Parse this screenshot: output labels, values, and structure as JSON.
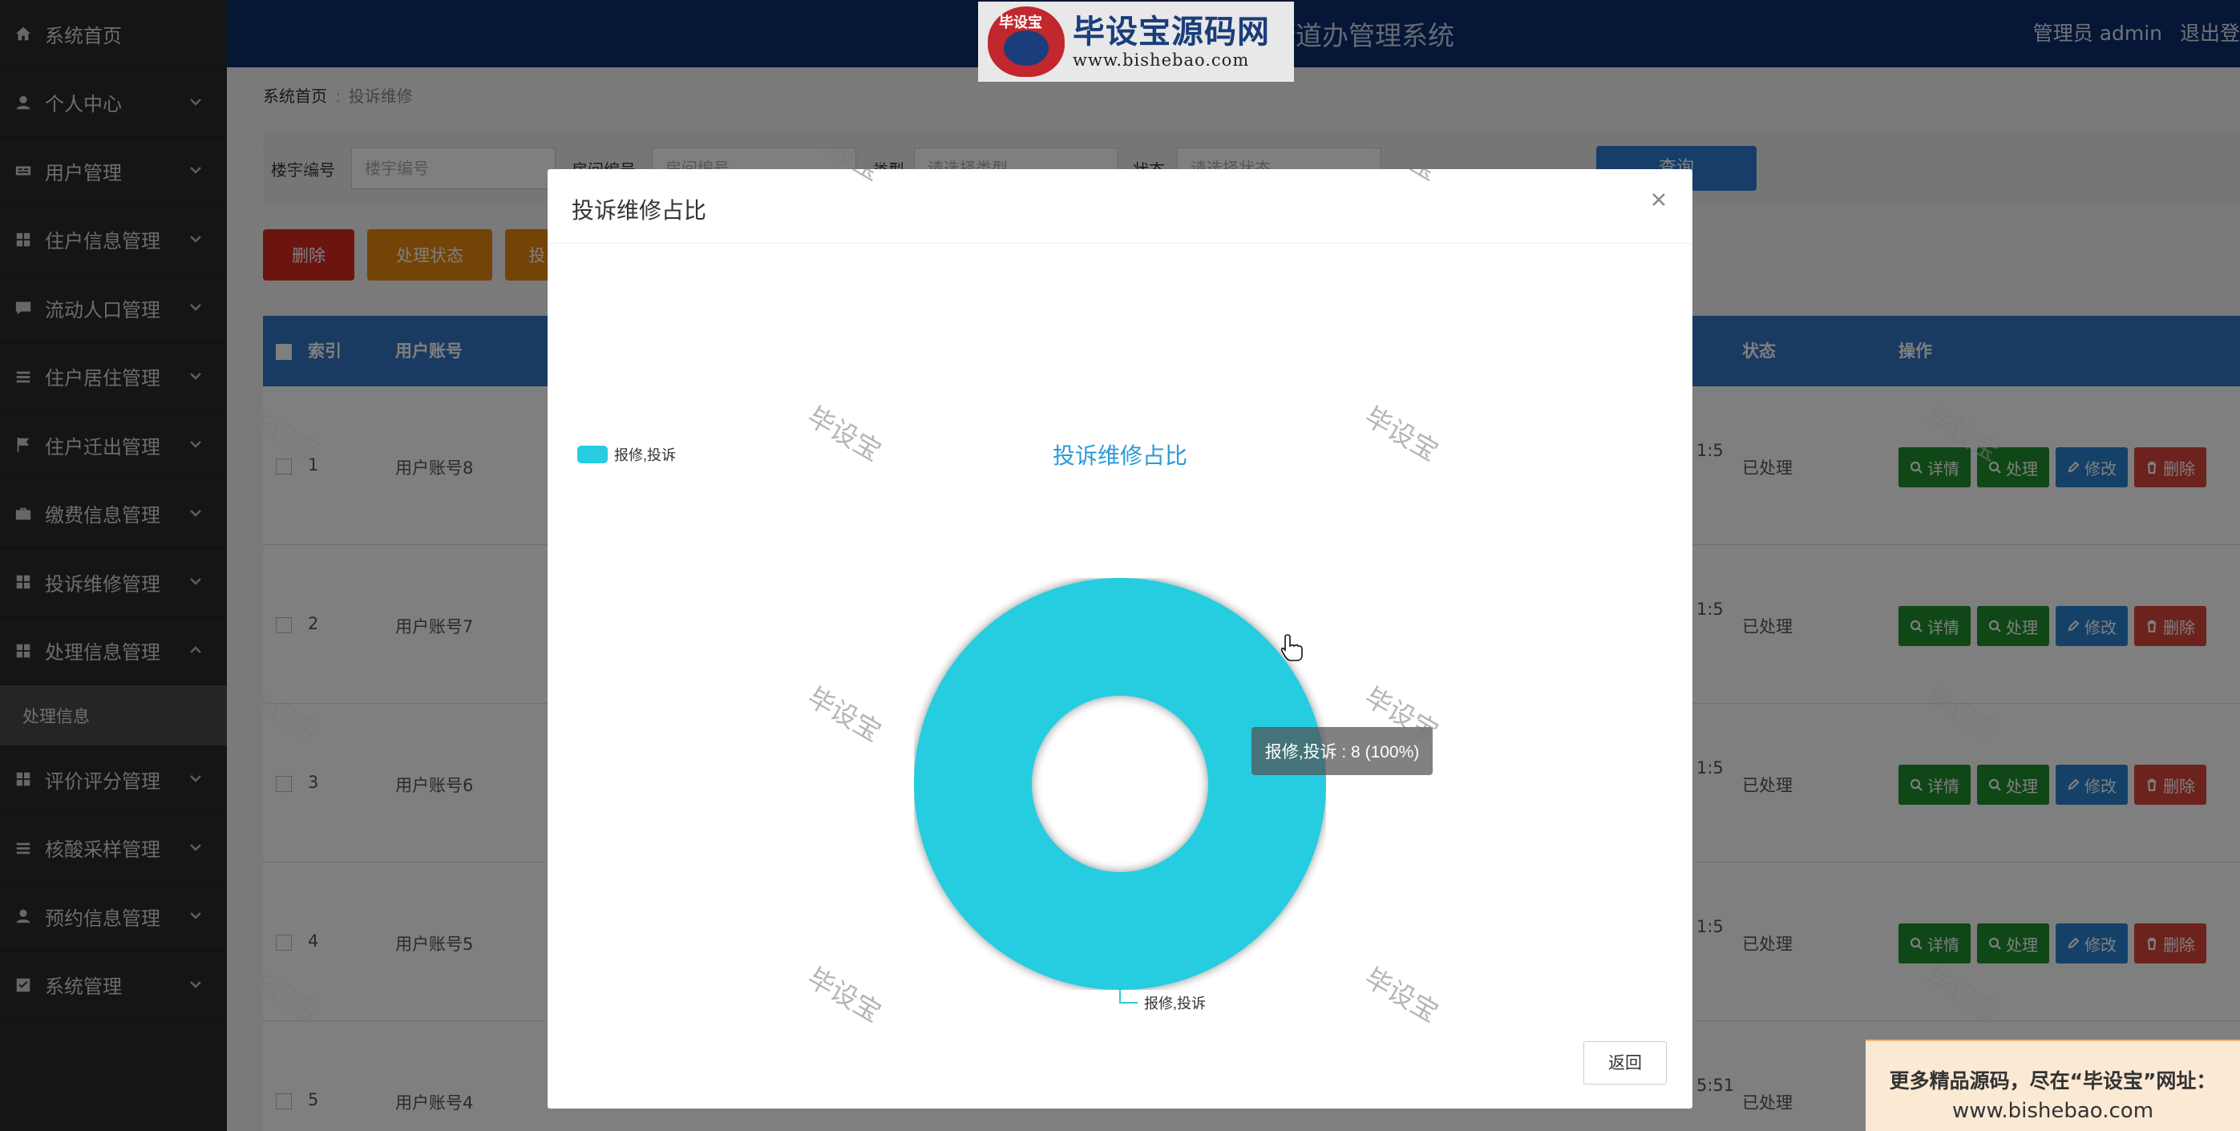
{
  "sidebar": {
    "items": [
      {
        "label": "系统首页",
        "icon": "home-icon",
        "chevron": false
      },
      {
        "label": "个人中心",
        "icon": "user-icon",
        "chevron": true
      },
      {
        "label": "用户管理",
        "icon": "id-card-icon",
        "chevron": true
      },
      {
        "label": "住户信息管理",
        "icon": "grid-icon",
        "chevron": true
      },
      {
        "label": "流动人口管理",
        "icon": "chat-icon",
        "chevron": true
      },
      {
        "label": "住户居住管理",
        "icon": "list-icon",
        "chevron": true
      },
      {
        "label": "住户迁出管理",
        "icon": "flag-icon",
        "chevron": true
      },
      {
        "label": "缴费信息管理",
        "icon": "briefcase-icon",
        "chevron": true
      },
      {
        "label": "投诉维修管理",
        "icon": "grid-icon",
        "chevron": true
      },
      {
        "label": "处理信息管理",
        "icon": "grid-icon",
        "chevron": true,
        "expanded": true
      }
    ],
    "sub_item": "处理信息",
    "items_after": [
      {
        "label": "评价评分管理",
        "icon": "grid-icon",
        "chevron": true
      },
      {
        "label": "核酸采样管理",
        "icon": "list-icon",
        "chevron": true
      },
      {
        "label": "预约信息管理",
        "icon": "user-icon",
        "chevron": true
      },
      {
        "label": "系统管理",
        "icon": "check-square-icon",
        "chevron": true
      }
    ]
  },
  "header": {
    "title": "街道办管理系统",
    "admin": "管理员 admin",
    "logout": "退出登",
    "brand_big": "毕设宝源码网",
    "brand_url": "www.bishebao.com",
    "brand_seal": "毕设宝"
  },
  "breadcrumb": {
    "home": "系统首页",
    "current": "投诉维修"
  },
  "search": {
    "label1": "楼宇编号",
    "placeholder1": "楼宇编号",
    "label2": "房间编号",
    "placeholder2": "房间编号",
    "label3": "类型",
    "placeholder3": "请选择类型",
    "label4": "状态",
    "placeholder4": "请选择状态",
    "query": "查询"
  },
  "actions": {
    "delete": "删除",
    "status": "处理状态",
    "third": "投"
  },
  "table": {
    "headers": {
      "index": "索引",
      "account": "用户账号",
      "status": "状态",
      "ops": "操作"
    },
    "rows": [
      {
        "index": "1",
        "account": "用户账号8",
        "time": "1:5",
        "status": "已处理"
      },
      {
        "index": "2",
        "account": "用户账号7",
        "time": "1:5",
        "status": "已处理"
      },
      {
        "index": "3",
        "account": "用户账号6",
        "time": "1:5",
        "status": "已处理"
      },
      {
        "index": "4",
        "account": "用户账号5",
        "time": "1:5",
        "status": "已处理"
      },
      {
        "index": "5",
        "account": "用户账号4",
        "time": "5:51",
        "status": "已处理"
      }
    ],
    "op_labels": {
      "detail": "详情",
      "handle": "处理",
      "edit": "修改",
      "delete": "删除"
    }
  },
  "modal": {
    "title": "投诉维修占比",
    "return": "返回"
  },
  "chart_data": {
    "type": "pie",
    "title": "投诉维修占比",
    "categories": [
      "报修,投诉"
    ],
    "values": [
      8
    ],
    "legend": [
      "报修,投诉"
    ],
    "legend_position": "top-left",
    "donut": true,
    "tooltip": "报修,投诉 : 8 (100%)",
    "colors": [
      "#27cce0"
    ]
  },
  "watermark": "毕设宝",
  "promo": {
    "line1": "更多精品源码，尽在“毕设宝”网址：",
    "line2": "www.bishebao.com"
  },
  "colors": {
    "sidebar": "#2b2b2b",
    "header": "#0a2d6e",
    "accent": "#27cce0"
  }
}
